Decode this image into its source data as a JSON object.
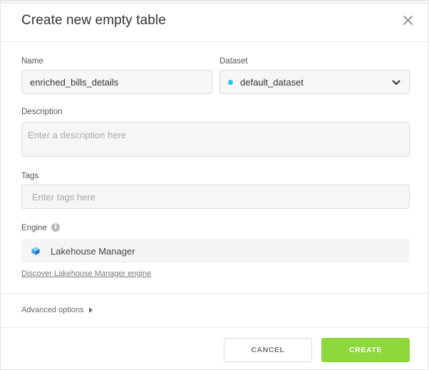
{
  "dialog": {
    "title": "Create new empty table"
  },
  "form": {
    "name": {
      "label": "Name",
      "value": "enriched_bills_details"
    },
    "dataset": {
      "label": "Dataset",
      "value": "default_dataset",
      "dot_color": "#1cc6e8"
    },
    "description": {
      "label": "Description",
      "placeholder": "Enter a description here"
    },
    "tags": {
      "label": "Tags",
      "placeholder": "Enter tags here"
    },
    "engine": {
      "label": "Engine",
      "value": "Lakehouse Manager",
      "icon": "lakehouse-engine-icon",
      "discover_link": "Discover Lakehouse Manager engine"
    },
    "advanced_options": "Advanced options"
  },
  "footer": {
    "cancel_label": "CANCEL",
    "create_label": "CREATE",
    "create_color": "#8ed73c"
  }
}
